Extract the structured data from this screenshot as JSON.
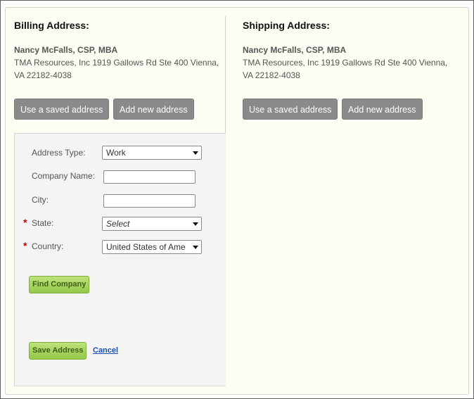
{
  "billing": {
    "heading": "Billing Address:",
    "name": "Nancy McFalls, CSP, MBA",
    "address": "TMA Resources, Inc 1919 Gallows Rd Ste 400 Vienna, VA   22182-4038",
    "use_saved_label": "Use a saved address",
    "add_new_label": "Add new address"
  },
  "shipping": {
    "heading": "Shipping Address:",
    "name": "Nancy McFalls, CSP, MBA",
    "address": "TMA Resources, Inc 1919 Gallows Rd Ste 400 Vienna, VA   22182-4038",
    "use_saved_label": "Use a saved address",
    "add_new_label": "Add new address"
  },
  "form": {
    "address_type_label": "Address Type:",
    "address_type_value": "Work",
    "company_name_label": "Company Name:",
    "company_name_value": "",
    "city_label": "City:",
    "city_value": "",
    "required_marker": "*",
    "state_label": "State:",
    "state_value": "Select",
    "country_label": "Country:",
    "country_value": "United States of Ame",
    "find_company_label": "Find Company",
    "save_address_label": "Save Address",
    "cancel_label": "Cancel"
  },
  "colors": {
    "panel_bg": "#fdfdf4",
    "gray_button": "#8a8a8a",
    "green_button": "#a9d45f",
    "required": "#cc0000",
    "link": "#1a4fb5"
  }
}
